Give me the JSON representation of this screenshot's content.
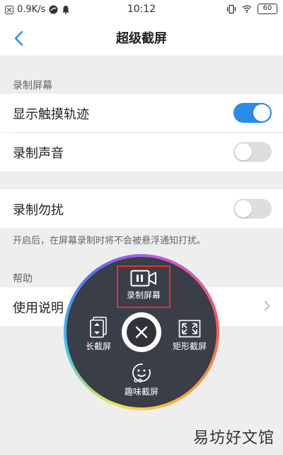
{
  "status_bar": {
    "speed": "0.9K/s",
    "time": "10:12",
    "battery": "60"
  },
  "header": {
    "title": "超级截屏"
  },
  "section_record": {
    "label": "录制屏幕",
    "items": [
      {
        "label": "显示触摸轨迹",
        "enabled": true
      },
      {
        "label": "录制声音",
        "enabled": false
      }
    ]
  },
  "dnd": {
    "label": "录制勿扰",
    "enabled": false,
    "hint": "开启后，在屏幕录制时将不会被悬浮通知打扰。"
  },
  "section_help": {
    "label": "帮助",
    "item": "使用说明"
  },
  "float_menu": {
    "record": "录制屏幕",
    "long": "长截屏",
    "rect": "矩形截屏",
    "fun": "趣味截屏"
  },
  "watermark": "易坊好文馆",
  "colors": {
    "accent": "#2a8ce8",
    "highlight": "#e23030"
  }
}
